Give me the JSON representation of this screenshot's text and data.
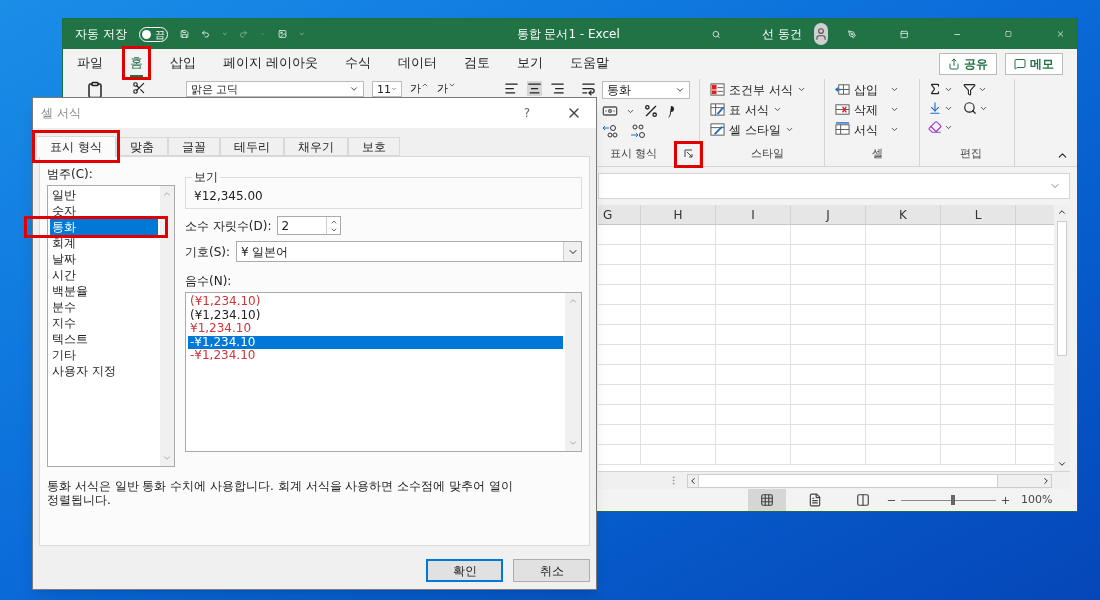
{
  "excel": {
    "title_bar": {
      "autosave_label": "자동 저장",
      "autosave_state": "끔",
      "autosave_on": false,
      "title": "통합 문서1 - Excel",
      "user": "선 동건"
    },
    "menu_tabs": [
      {
        "label": "파일",
        "selected": false,
        "highlighted": false
      },
      {
        "label": "홈",
        "selected": true,
        "highlighted": true
      },
      {
        "label": "삽입",
        "selected": false,
        "highlighted": false
      },
      {
        "label": "페이지 레이아웃",
        "selected": false,
        "highlighted": false
      },
      {
        "label": "수식",
        "selected": false,
        "highlighted": false
      },
      {
        "label": "데이터",
        "selected": false,
        "highlighted": false
      },
      {
        "label": "검토",
        "selected": false,
        "highlighted": false
      },
      {
        "label": "보기",
        "selected": false,
        "highlighted": false
      },
      {
        "label": "도움말",
        "selected": false,
        "highlighted": false
      }
    ],
    "share_button": "공유",
    "comments_button": "메모",
    "ribbon": {
      "font_name": "맑은 고딕",
      "font_size": "11",
      "grow_font": "가",
      "shrink_font": "가",
      "number_format": "통화",
      "number_group": "표시 형식",
      "launcher_highlighted": true,
      "styles": [
        "조건부 서식",
        "표 서식",
        "셀 스타일"
      ],
      "styles_group": "스타일",
      "cells": [
        "삽입",
        "삭제",
        "서식"
      ],
      "cells_group": "셀",
      "editing_group": "편집"
    },
    "columns": [
      "G",
      "H",
      "I",
      "J",
      "K",
      "L"
    ],
    "views": [
      {
        "kind": "normal",
        "selected": true
      },
      {
        "kind": "page_layout",
        "selected": false
      },
      {
        "kind": "page_break",
        "selected": false
      }
    ],
    "zoom": {
      "level": 0.55,
      "reading": "100%"
    }
  },
  "dialog": {
    "title": "셀 서식",
    "help": "?",
    "tabs": [
      {
        "label": "표시 형식",
        "selected": true,
        "highlighted": true
      },
      {
        "label": "맞춤",
        "selected": false,
        "highlighted": false
      },
      {
        "label": "글꼴",
        "selected": false,
        "highlighted": false
      },
      {
        "label": "테두리",
        "selected": false,
        "highlighted": false
      },
      {
        "label": "채우기",
        "selected": false,
        "highlighted": false
      },
      {
        "label": "보호",
        "selected": false,
        "highlighted": false
      }
    ],
    "category_label": "범주(C):",
    "categories": [
      {
        "label": "일반",
        "selected": false,
        "highlighted": false
      },
      {
        "label": "숫자",
        "selected": false,
        "highlighted": false
      },
      {
        "label": "통화",
        "selected": true,
        "highlighted": true
      },
      {
        "label": "회계",
        "selected": false,
        "highlighted": false
      },
      {
        "label": "날짜",
        "selected": false,
        "highlighted": false
      },
      {
        "label": "시간",
        "selected": false,
        "highlighted": false
      },
      {
        "label": "백분율",
        "selected": false,
        "highlighted": false
      },
      {
        "label": "분수",
        "selected": false,
        "highlighted": false
      },
      {
        "label": "지수",
        "selected": false,
        "highlighted": false
      },
      {
        "label": "텍스트",
        "selected": false,
        "highlighted": false
      },
      {
        "label": "기타",
        "selected": false,
        "highlighted": false
      },
      {
        "label": "사용자 지정",
        "selected": false,
        "highlighted": false
      }
    ],
    "sample_label": "보기",
    "sample_value": "¥12,345.00",
    "decimal_label": "소수 자릿수(D):",
    "decimal_value": "2",
    "symbol_label": "기호(S):",
    "symbol_value": "¥ 일본어",
    "negative_label": "음수(N):",
    "negatives": [
      {
        "label": "(¥1,234.10)",
        "color": "#d13438",
        "selected": false
      },
      {
        "label": "(¥1,234.10)",
        "color": "#222222",
        "selected": false
      },
      {
        "label": "¥1,234.10",
        "color": "#d13438",
        "selected": false
      },
      {
        "label": "-¥1,234.10",
        "selected": true
      },
      {
        "label": "-¥1,234.10",
        "color": "#d13438",
        "selected": false
      }
    ],
    "description": "통화 서식은 일반 통화 수치에 사용합니다. 회계 서식을 사용하면 소수점에 맞추어 열이 정렬됩니다.",
    "buttons": [
      {
        "label": "확인",
        "default": true
      },
      {
        "label": "취소",
        "default": false
      }
    ]
  }
}
